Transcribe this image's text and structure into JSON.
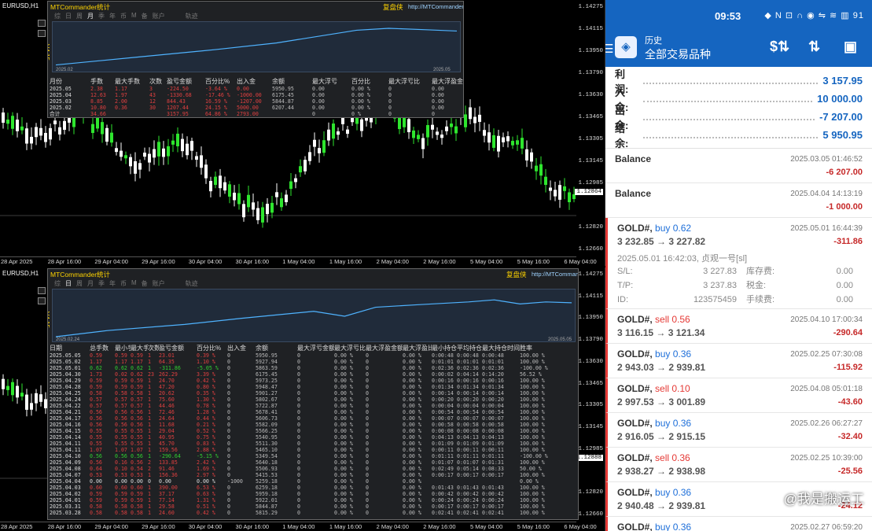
{
  "chart_top": {
    "symbol": "EURUSD,H1",
    "prices": [
      "1.14275",
      "1.14115",
      "1.13950",
      "1.13790",
      "1.13630",
      "1.13465",
      "1.13305",
      "1.13145",
      "1.12985",
      "1.12864",
      "1.12820",
      "1.12660"
    ],
    "times": [
      "28 Apr 2025",
      "28 Apr 16:00",
      "29 Apr 04:00",
      "29 Apr 16:00",
      "30 Apr 04:00",
      "30 Apr 16:00",
      "1 May 04:00",
      "1 May 16:00",
      "2 May 04:00",
      "2 May 16:00",
      "5 May 04:00",
      "5 May 16:00",
      "6 May 04:00"
    ]
  },
  "chart_bot": {
    "symbol": "EURUSD,H1",
    "prices": [
      "1.14275",
      "1.14115",
      "1.13950",
      "1.13790",
      "1.13630",
      "1.13465",
      "1.13305",
      "1.13145",
      "1.12985",
      "1.12888",
      "1.12820",
      "1.12660"
    ],
    "times": [
      "28 Apr 2025",
      "28 Apr 16:00",
      "29 Apr 04:00",
      "29 Apr 16:00",
      "30 Apr 04:00",
      "30 Apr 16:00",
      "1 May 04:00",
      "1 May 16:00",
      "2 May 04:00",
      "2 May 16:00",
      "5 May 04:00",
      "5 May 16:00",
      "6 May 04:00"
    ]
  },
  "stats_top": {
    "title": "MTCommander统计",
    "replay": "复盘侠",
    "url": "http://MTCommander.com",
    "tabs": [
      "综",
      "日",
      "周",
      "月",
      "季",
      "年",
      "币",
      "M",
      "备",
      "账户"
    ],
    "active_tab": "月",
    "track": "轨迹",
    "axis_start": "2025.02",
    "axis_end": "2025.05",
    "version": "V4.15",
    "headers": [
      "月份",
      "手数",
      "最大手数",
      "次数",
      "盈亏金额",
      "百分比%",
      "出入金",
      "余额",
      "最大浮亏",
      "百分比",
      "最大浮亏比",
      "最大浮盈金额",
      "最大浮盈比例"
    ],
    "rows": [
      [
        "2025.05",
        "2.38",
        "1.17",
        "3",
        "-224.50",
        "-3.64 %",
        "0.00",
        "5950.95",
        "0.00",
        "0.00 %",
        "0",
        "0.00",
        "0.00 %"
      ],
      [
        "2025.04",
        "12.63",
        "1.97",
        "43",
        "-1330.68",
        "-17.46 %",
        "-1000.00",
        "6175.45",
        "0.00",
        "0.00 %",
        "0",
        "0.00",
        "0.00 %"
      ],
      [
        "2025.03",
        "8.85",
        "2.00",
        "12",
        "844.43",
        "16.59 %",
        "-1207.00",
        "5844.87",
        "0.00",
        "0.00 %",
        "0",
        "0.00",
        "0.00 %"
      ],
      [
        "2025.02",
        "10.80",
        "0.36",
        "30",
        "1207.44",
        "24.15 %",
        "5000.00",
        "6207.44",
        "0.00",
        "0.00 %",
        "0",
        "0.00",
        "0.00 %"
      ],
      [
        "合计",
        "34.66",
        "",
        "",
        "3157.95",
        "64.86 %",
        "2793.00",
        "",
        "0",
        "0 %",
        "0",
        "0",
        "0 %"
      ]
    ],
    "row_colors": [
      "neg",
      "neg",
      "neg",
      "neg",
      "neg"
    ]
  },
  "stats_bot": {
    "title": "MTCommander统计",
    "replay": "复盘侠",
    "url": "http://MTCommander.com",
    "tabs": [
      "综",
      "日",
      "周",
      "月",
      "季",
      "年",
      "币",
      "M",
      "备",
      "账户"
    ],
    "active_tab": "日",
    "track": "轨迹",
    "axis_start": "2025.02.24",
    "axis_end": "2025.05.05",
    "version": "V4.15",
    "headers": [
      "日期",
      "总手数",
      "最小手数",
      "最大手数",
      "次数",
      "盈亏金额",
      "百分比%",
      "出入金",
      "余额",
      "最大浮亏金额",
      "最大浮亏比",
      "最大浮盈金额",
      "最大浮盈比",
      "最小持仓",
      "平均持仓",
      "最大持仓时间",
      "胜率"
    ],
    "rows": [
      [
        "2025.05.05",
        "0.59",
        "0.59",
        "0.59",
        "1",
        "23.01",
        "0.39 %",
        "0",
        "5950.95",
        "0",
        "0.00 %",
        "0",
        "0.00 %",
        "0:00:48",
        "0:00:48",
        "0:00:48",
        "100.00 %"
      ],
      [
        "2025.05.02",
        "1.17",
        "1.17",
        "1.17",
        "1",
        "64.35",
        "1.10 %",
        "0",
        "5927.94",
        "0",
        "0.00 %",
        "0",
        "0.00 %",
        "0:01:01",
        "0:01:01",
        "0:01:01",
        "100.00 %"
      ],
      [
        "2025.05.01",
        "0.62",
        "0.62",
        "0.62",
        "1",
        "-311.86",
        "-5.05 %",
        "0",
        "5863.59",
        "0",
        "0.00 %",
        "0",
        "0.00 %",
        "0:02:36",
        "0:02:36",
        "0:02:36",
        "-100.00 %"
      ],
      [
        "2025.04.30",
        "1.73",
        "0.02",
        "0.62",
        "23",
        "262.29",
        "3.39 %",
        "0",
        "6175.45",
        "0",
        "0.00 %",
        "0",
        "0.00 %",
        "0:00:02",
        "0:04:14",
        "0:14:20",
        "56.52 %"
      ],
      [
        "2025.04.29",
        "0.59",
        "0.59",
        "0.59",
        "1",
        "24.70",
        "0.42 %",
        "0",
        "5973.25",
        "0",
        "0.00 %",
        "0",
        "0.00 %",
        "0:00:16",
        "0:00:16",
        "0:00:16",
        "100.00 %"
      ],
      [
        "2025.04.28",
        "0.59",
        "0.59",
        "0.59",
        "1",
        "47.20",
        "0.80 %",
        "0",
        "5948.47",
        "0",
        "0.00 %",
        "0",
        "0.00 %",
        "0:01:34",
        "0:01:34",
        "0:01:34",
        "100.00 %"
      ],
      [
        "2025.04.25",
        "0.58",
        "0.58",
        "0.58",
        "1",
        "20.62",
        "0.35 %",
        "0",
        "5901.27",
        "0",
        "0.00 %",
        "0",
        "0.00 %",
        "0:00:14",
        "0:00:14",
        "0:00:14",
        "100.00 %"
      ],
      [
        "2025.04.24",
        "0.57",
        "0.57",
        "0.57",
        "1",
        "75.60",
        "1.30 %",
        "0",
        "5802.67",
        "0",
        "0.00 %",
        "0",
        "0.00 %",
        "0:00:20",
        "0:00:20",
        "0:00:20",
        "100.00 %"
      ],
      [
        "2025.04.22",
        "0.57",
        "0.57",
        "0.57",
        "1",
        "44.46",
        "0.78 %",
        "0",
        "5722.87",
        "0",
        "0.00 %",
        "0",
        "0.00 %",
        "0:00:04",
        "0:00:04",
        "0:00:04",
        "100.00 %"
      ],
      [
        "2025.04.21",
        "0.56",
        "0.56",
        "0.56",
        "1",
        "72.46",
        "1.28 %",
        "0",
        "5678.41",
        "0",
        "0.00 %",
        "0",
        "0.00 %",
        "0:00:54",
        "0:00:54",
        "0:00:54",
        "100.00 %"
      ],
      [
        "2025.04.17",
        "0.56",
        "0.56",
        "0.56",
        "1",
        "24.64",
        "0.44 %",
        "0",
        "5606.73",
        "0",
        "0.00 %",
        "0",
        "0.00 %",
        "0:00:07",
        "0:00:07",
        "0:00:07",
        "100.00 %"
      ],
      [
        "2025.04.16",
        "0.56",
        "0.56",
        "0.56",
        "1",
        "11.68",
        "0.21 %",
        "0",
        "5582.09",
        "0",
        "0.00 %",
        "0",
        "0.00 %",
        "0:00:58",
        "0:00:58",
        "0:00:58",
        "100.00 %"
      ],
      [
        "2025.04.15",
        "0.55",
        "0.55",
        "0.55",
        "1",
        "29.04",
        "0.52 %",
        "0",
        "5566.25",
        "0",
        "0.00 %",
        "0",
        "0.00 %",
        "0:00:08",
        "0:00:08",
        "0:00:08",
        "100.00 %"
      ],
      [
        "2025.04.14",
        "0.55",
        "0.55",
        "0.55",
        "1",
        "40.95",
        "0.75 %",
        "0",
        "5540.95",
        "0",
        "0.00 %",
        "0",
        "0.00 %",
        "0:04:13",
        "0:04:13",
        "0:04:13",
        "100.00 %"
      ],
      [
        "2025.04.11",
        "0.55",
        "0.55",
        "0.55",
        "1",
        "45.70",
        "0.83 %",
        "0",
        "5511.30",
        "0",
        "0.00 %",
        "0",
        "0.00 %",
        "0:01:09",
        "0:01:09",
        "0:01:09",
        "100.00 %"
      ],
      [
        "2025.04.11",
        "1.07",
        "1.07",
        "1.07",
        "1",
        "159.56",
        "2.88 %",
        "0",
        "5465.10",
        "0",
        "0.00 %",
        "0",
        "0.00 %",
        "0:00:11",
        "0:00:11",
        "0:00:11",
        "100.00 %"
      ],
      [
        "2025.04.10",
        "0.56",
        "0.56",
        "0.56",
        "1",
        "-290.64",
        "-5.15 %",
        "0",
        "5349.54",
        "0",
        "0.00 %",
        "0",
        "0.00 %",
        "0:01:11",
        "0:01:11",
        "0:01:11",
        "-100.00 %"
      ],
      [
        "2025.04.09",
        "0.56",
        "0.16",
        "0.56",
        "2",
        "133.85",
        "2.42 %",
        "0",
        "5640.18",
        "0",
        "0.00 %",
        "0",
        "0.00 %",
        "0:01:07",
        "0:01:07",
        "0:01:31",
        "100.00 %"
      ],
      [
        "2025.04.08",
        "0.64",
        "0.10",
        "0.54",
        "2",
        "91.46",
        "1.69 %",
        "0",
        "5506.93",
        "0",
        "0.00 %",
        "0",
        "0.00 %",
        "0:02:49",
        "0:05:14",
        "0:08:33",
        "50.00 %"
      ],
      [
        "2025.04.07",
        "0.53",
        "0.53",
        "0.53",
        "1",
        "156.36",
        "2.97 %",
        "0",
        "5415.53",
        "0",
        "0.00 %",
        "0",
        "0.00 %",
        "0:00:17",
        "0:00:17",
        "0:00:17",
        "100.00 %"
      ],
      [
        "2025.04.04",
        "0.00",
        "0.00",
        "0.00",
        "0",
        "0.00",
        "0.00 %",
        "-1000",
        "5259.18",
        "0",
        "0.00 %",
        "0",
        "0.00 %",
        "",
        "",
        "",
        "0.00 %"
      ],
      [
        "2025.04.03",
        "0.60",
        "0.60",
        "0.60",
        "1",
        "390.00",
        "6.53 %",
        "0",
        "6259.18",
        "0",
        "0.00 %",
        "0",
        "0.00 %",
        "0:01:43",
        "0:01:43",
        "0:01:43",
        "100.00 %"
      ],
      [
        "2025.04.02",
        "0.59",
        "0.59",
        "0.59",
        "1",
        "37.17",
        "0.63 %",
        "0",
        "5959.18",
        "0",
        "0.00 %",
        "0",
        "0.00 %",
        "0:00:42",
        "0:00:42",
        "0:00:42",
        "100.00 %"
      ],
      [
        "2025.04.01",
        "0.59",
        "0.59",
        "0.59",
        "1",
        "77.14",
        "1.31 %",
        "0",
        "5922.01",
        "0",
        "0.00 %",
        "0",
        "0.00 %",
        "0:00:24",
        "0:00:24",
        "0:00:24",
        "100.00 %"
      ],
      [
        "2025.03.31",
        "0.58",
        "0.58",
        "0.58",
        "1",
        "29.58",
        "0.51 %",
        "0",
        "5844.87",
        "0",
        "0.00 %",
        "0",
        "0.00 %",
        "0:00:17",
        "0:00:17",
        "0:00:17",
        "100.00 %"
      ],
      [
        "2025.03.28",
        "0.58",
        "0.58",
        "0.58",
        "1",
        "24.60",
        "0.42 %",
        "0",
        "5815.29",
        "0",
        "0.00 %",
        "0",
        "0.00 %",
        "0:02:41",
        "0:02:41",
        "0:02:41",
        "100.00 %"
      ]
    ],
    "row_colors": [
      "neg",
      "neg",
      "grn",
      "neg",
      "neg",
      "neg",
      "neg",
      "neg",
      "neg",
      "neg",
      "neg",
      "neg",
      "neg",
      "neg",
      "neg",
      "neg",
      "grn",
      "neg",
      "neg",
      "neg",
      "white",
      "neg",
      "neg",
      "neg",
      "neg",
      "neg"
    ]
  },
  "phone": {
    "status": {
      "time": "09:53",
      "icons": "◆ N ⊡ ∩ ◉ ⇋ ≋ ▥ 91"
    },
    "appbar": {
      "subtitle": "历史",
      "title": "全部交易品种",
      "icon_dollar": "$⇅",
      "icon_sort": "⇅",
      "icon_calendar": "▣",
      "menu": "☰"
    },
    "summary": [
      {
        "label": "利润:",
        "value": "3 157.95"
      },
      {
        "label": "入金:",
        "value": "10 000.00"
      },
      {
        "label": "出金:",
        "value": "-7 207.00"
      },
      {
        "label": "结余:",
        "value": "5 950.95"
      }
    ],
    "balances": [
      {
        "title": "Balance",
        "date": "2025.03.05 01:46:52",
        "amount": "-6 207.00"
      },
      {
        "title": "Balance",
        "date": "2025.04.04 14:13:19",
        "amount": "-1 000.00"
      }
    ],
    "expanded": {
      "symbol": "GOLD#,",
      "side": "buy 0.62",
      "side_type": "buy",
      "date": "2025.05.01 16:44:39",
      "price": "3 232.85 → 3 227.82",
      "pl": "-311.86",
      "detail": "2025.05.01 16:42:03, 贞观一号[sl]",
      "sl_label": "S/L:",
      "sl": "3 227.83",
      "swap_label": "库存费:",
      "swap": "0.00",
      "tp_label": "T/P:",
      "tp": "3 237.83",
      "tax_label": "税金:",
      "tax": "0.00",
      "id_label": "ID:",
      "id": "123575459",
      "fee_label": "手续费:",
      "fee": "0.00"
    },
    "trades": [
      {
        "symbol": "GOLD#,",
        "side": "sell 0.56",
        "side_type": "sell",
        "date": "2025.04.10 17:00:34",
        "price": "3 116.15 → 3 121.34",
        "pl": "-290.64"
      },
      {
        "symbol": "GOLD#,",
        "side": "buy 0.36",
        "side_type": "buy",
        "date": "2025.02.25 07:30:08",
        "price": "2 943.03 → 2 939.81",
        "pl": "-115.92"
      },
      {
        "symbol": "GOLD#,",
        "side": "sell 0.10",
        "side_type": "sell",
        "date": "2025.04.08 05:01:18",
        "price": "2 997.53 → 3 001.89",
        "pl": "-43.60"
      },
      {
        "symbol": "GOLD#,",
        "side": "buy 0.36",
        "side_type": "buy",
        "date": "2025.02.26 06:27:27",
        "price": "2 916.05 → 2 915.15",
        "pl": "-32.40"
      },
      {
        "symbol": "GOLD#,",
        "side": "sell 0.36",
        "side_type": "sell",
        "date": "2025.02.25 10:39:00",
        "price": "2 938.27 → 2 938.98",
        "pl": "-25.56"
      },
      {
        "symbol": "GOLD#,",
        "side": "buy 0.36",
        "side_type": "buy",
        "date": "",
        "price": "2 940.48 → 2 939.81",
        "pl": "-24.12"
      },
      {
        "symbol": "GOLD#,",
        "side": "buy 0.36",
        "side_type": "buy",
        "date": "2025.02.27 06:59:20",
        "price": "",
        "pl": ""
      }
    ],
    "watermark": "@我是搬运工"
  },
  "colors": {
    "bull": "#2ee62e",
    "bear": "#ffffff",
    "curve": "#4fb3ff",
    "accent": "#1565c0",
    "neg": "#c62828"
  }
}
